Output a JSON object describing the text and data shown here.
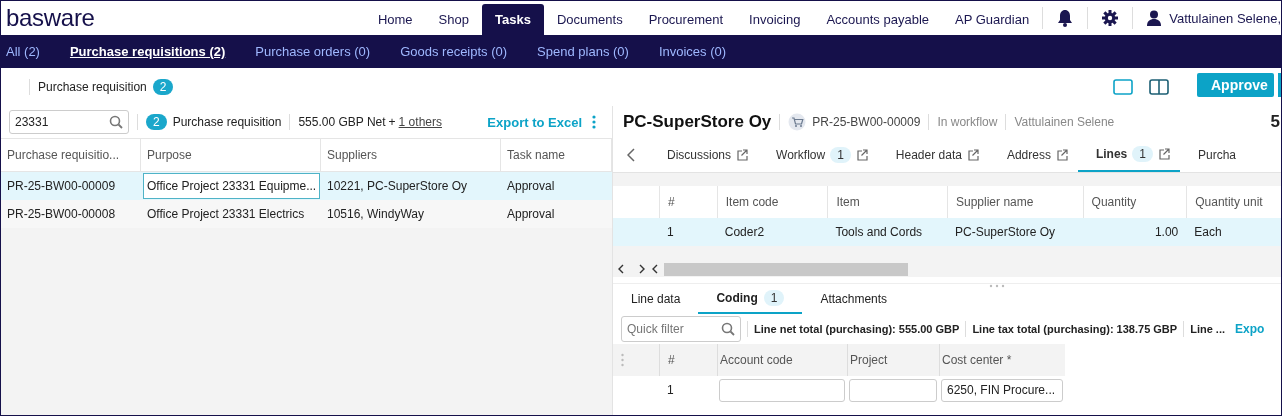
{
  "header": {
    "logo": "basware",
    "nav": [
      {
        "label": "Home",
        "selected": false
      },
      {
        "label": "Shop",
        "selected": false
      },
      {
        "label": "Tasks",
        "selected": true
      },
      {
        "label": "Documents",
        "selected": false
      },
      {
        "label": "Procurement",
        "selected": false
      },
      {
        "label": "Invoicing",
        "selected": false
      },
      {
        "label": "Accounts payable",
        "selected": false
      },
      {
        "label": "AP Guardian",
        "selected": false
      }
    ],
    "user": "Vattulainen Selene,"
  },
  "subnav": [
    {
      "label": "All (2)",
      "selected": false
    },
    {
      "label": "Purchase requisitions (2)",
      "selected": true
    },
    {
      "label": "Purchase orders (0)",
      "selected": false
    },
    {
      "label": "Goods receipts (0)",
      "selected": false
    },
    {
      "label": "Spend plans (0)",
      "selected": false
    },
    {
      "label": "Invoices (0)",
      "selected": false
    }
  ],
  "toolbar": {
    "title": "Purchase requisition",
    "count": "2",
    "approve": "Approve"
  },
  "list": {
    "search": "23331",
    "count": "2",
    "label": "Purchase requisition",
    "net": "555.00 GBP Net",
    "plus": "+",
    "others": "1 others",
    "export": "Export to Excel",
    "columns": [
      "Purchase requisitio...",
      "Purpose",
      "Suppliers",
      "Task name"
    ],
    "rows": [
      {
        "selected": true,
        "cells": [
          "PR-25-BW00-00009",
          "Office Project 23331 Equipme...",
          "10221, PC-SuperStore Oy",
          "Approval"
        ]
      },
      {
        "selected": false,
        "cells": [
          "PR-25-BW00-00008",
          "Office Project 23331 Electrics",
          "10516, WindyWay",
          "Approval"
        ]
      }
    ]
  },
  "detail": {
    "title": "PC-SuperStore Oy",
    "id": "PR-25-BW00-00009",
    "status": "In workflow",
    "owner": "Vattulainen Selene",
    "amount": "5",
    "tabs": [
      {
        "label": "Discussions",
        "external": true,
        "selected": false
      },
      {
        "label": "Workflow",
        "badge": "1",
        "external": true,
        "selected": false
      },
      {
        "label": "Header data",
        "external": true,
        "selected": false
      },
      {
        "label": "Address",
        "external": true,
        "selected": false
      },
      {
        "label": "Lines",
        "badge": "1",
        "external": true,
        "selected": true
      },
      {
        "label": "Purcha",
        "external": false,
        "selected": false
      }
    ],
    "lines": {
      "columns": [
        "#",
        "Item code",
        "Item",
        "Supplier name",
        "Quantity",
        "Quantity unit"
      ],
      "rows": [
        {
          "selected": true,
          "cells": [
            "1",
            "Coder2",
            "Tools and Cords",
            "PC-SuperStore Oy",
            "1.00",
            "Each"
          ]
        }
      ]
    },
    "subtabs": [
      {
        "label": "Line data",
        "selected": false
      },
      {
        "label": "Coding",
        "badge": "1",
        "selected": true
      },
      {
        "label": "Attachments",
        "selected": false
      }
    ],
    "filter": {
      "placeholder": "Quick filter"
    },
    "totals": [
      "Line net total (purchasing): 555.00 GBP",
      "Line tax total (purchasing): 138.75 GBP",
      "Line ..."
    ],
    "export": "Expo",
    "coding": {
      "columns": [
        "#",
        "Account code",
        "Project",
        "Cost center *"
      ],
      "rows": [
        {
          "number": "1",
          "cost_center": "6250, FIN Procure..."
        }
      ]
    }
  }
}
